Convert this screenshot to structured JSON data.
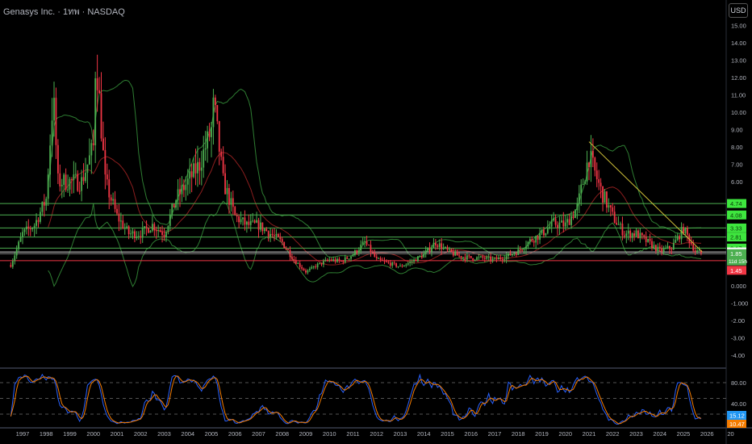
{
  "header": {
    "title": "Genasys Inc. · 1ทพ · NASDAQ",
    "currency_button": "USD"
  },
  "colors": {
    "up": "#4caf50",
    "down": "#f23645",
    "bb": "#2e7d32",
    "bb_mid": "#8b1e1e",
    "trend": "#d4c43a",
    "level": "#4caf50",
    "stoch_k": "#2962ff",
    "stoch_d": "#f57c00"
  },
  "chart_data": {
    "type": "candlestick",
    "x_ticks": [
      "1997",
      "1998",
      "1999",
      "2000",
      "2001",
      "2002",
      "2003",
      "2004",
      "2005",
      "2006",
      "2007",
      "2008",
      "2009",
      "2010",
      "2011",
      "2012",
      "2013",
      "2014",
      "2015",
      "2016",
      "2017",
      "2018",
      "2019",
      "2020",
      "2021",
      "2022",
      "2023",
      "2024",
      "2025",
      "2026",
      "20"
    ],
    "y_ticks": [
      "15.00",
      "14.00",
      "13.00",
      "12.00",
      "11.00",
      "10.00",
      "9.00",
      "8.00",
      "7.00",
      "6.00",
      "0.000",
      "-1.000",
      "-2.00",
      "-3.00",
      "-4.00"
    ],
    "y_tick_values": [
      15,
      14,
      13,
      12,
      11,
      10,
      9,
      8,
      7,
      6,
      0,
      -1,
      -2,
      -3,
      -4
    ],
    "ylim": [
      -4.5,
      15.5
    ],
    "price_path": {
      "years": [
        1996.5,
        1997,
        1997.5,
        1998,
        1998.3,
        1998.5,
        1999,
        1999.5,
        2000,
        2000.1,
        2000.5,
        2001,
        2001.5,
        2002,
        2002.5,
        2003,
        2003.5,
        2004,
        2004.5,
        2005,
        2005.1,
        2005.5,
        2006,
        2006.5,
        2007,
        2007.5,
        2008,
        2008.5,
        2009,
        2009.5,
        2010,
        2010.5,
        2011,
        2011.5,
        2012,
        2012.5,
        2013,
        2013.5,
        2014,
        2014.5,
        2015,
        2015.5,
        2016,
        2016.5,
        2017,
        2017.5,
        2018,
        2018.5,
        2019,
        2019.5,
        2020,
        2020.5,
        2021,
        2021.5,
        2022,
        2022.5,
        2023,
        2023.5,
        2024,
        2024.5,
        2025,
        2025.5,
        2025.8
      ],
      "prices": [
        1.2,
        3.0,
        3.5,
        5.0,
        11.0,
        6.0,
        6.0,
        6.0,
        8.0,
        13.5,
        6.0,
        4.0,
        3.0,
        3.0,
        3.5,
        3.0,
        5.0,
        6.0,
        7.0,
        9.0,
        10.5,
        6.0,
        4.0,
        3.5,
        3.5,
        3.0,
        2.5,
        1.5,
        0.8,
        1.2,
        1.5,
        1.4,
        1.8,
        2.5,
        1.5,
        1.3,
        1.1,
        1.4,
        1.8,
        2.5,
        2.0,
        1.7,
        1.6,
        1.6,
        1.5,
        1.7,
        2.0,
        2.6,
        3.0,
        3.6,
        3.5,
        4.5,
        7.5,
        5.5,
        4.0,
        3.0,
        3.0,
        2.5,
        2.0,
        2.2,
        3.3,
        2.0,
        1.85
      ]
    },
    "trendline": {
      "from": [
        2021.0,
        8.3
      ],
      "to": [
        2025.8,
        1.95
      ]
    },
    "levels": [
      {
        "value": 4.74,
        "label": "4.74",
        "kind": "support"
      },
      {
        "value": 4.08,
        "label": "4.08",
        "kind": "support"
      },
      {
        "value": 3.33,
        "label": "3.33",
        "kind": "support"
      },
      {
        "value": 2.81,
        "label": "2.81",
        "kind": "support"
      },
      {
        "value": 2.17,
        "label": "2.17",
        "kind": "support"
      },
      {
        "value": 1.95,
        "label": "1.95",
        "kind": "white"
      },
      {
        "value": 1.85,
        "label": "1.85",
        "kind": "last",
        "sub": "11d 15h"
      },
      {
        "value": 1.45,
        "label": "1.45",
        "kind": "red"
      }
    ],
    "oscillator": {
      "y_ticks": [
        "80.00",
        "40.00"
      ],
      "y_tick_values": [
        80,
        40
      ],
      "dashed_levels": [
        80,
        50,
        20
      ],
      "ylim": [
        0,
        100
      ],
      "k_label": "15.12",
      "d_label": "10.47"
    }
  }
}
